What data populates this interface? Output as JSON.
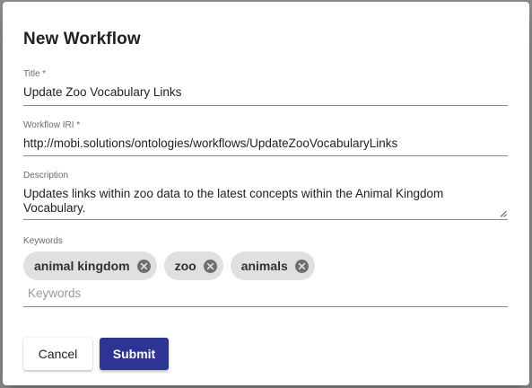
{
  "dialog": {
    "title": "New Workflow"
  },
  "fields": {
    "title": {
      "label": "Title *",
      "value": "Update Zoo Vocabulary Links"
    },
    "workflow_iri": {
      "label": "Workflow IRI *",
      "value": "http://mobi.solutions/ontologies/workflows/UpdateZooVocabularyLinks"
    },
    "description": {
      "label": "Description",
      "value": "Updates links within zoo data to the latest concepts within the Animal Kingdom Vocabulary."
    },
    "keywords": {
      "label": "Keywords",
      "placeholder": "Keywords",
      "chips": [
        {
          "label": "animal kingdom",
          "icon": "cancel-circle-icon"
        },
        {
          "label": "zoo",
          "icon": "cancel-circle-icon"
        },
        {
          "label": "animals",
          "icon": "cancel-circle-icon"
        }
      ]
    }
  },
  "actions": {
    "cancel_label": "Cancel",
    "submit_label": "Submit"
  },
  "colors": {
    "primary": "#2c3596",
    "chip_background": "#e0e0e0",
    "underline": "#8c8c8c"
  }
}
